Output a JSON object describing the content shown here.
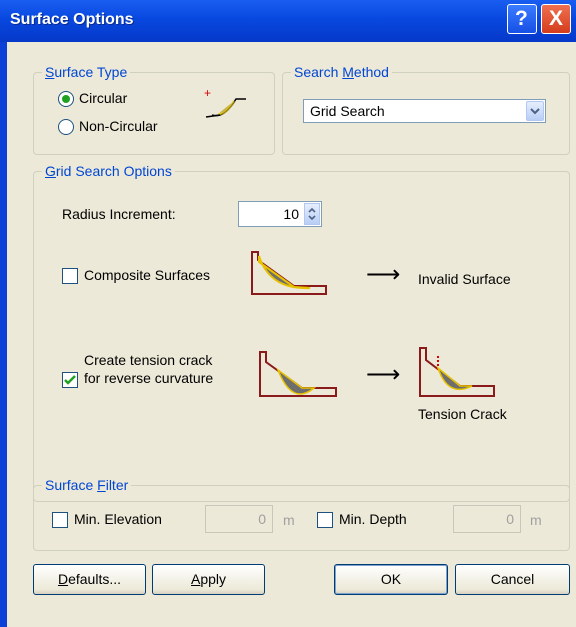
{
  "window": {
    "title": "Surface Options",
    "help_glyph": "?",
    "close_glyph": "X"
  },
  "surface_type": {
    "legend_prefix": "",
    "legend_u": "S",
    "legend_rest": "urface Type",
    "option_circular": "Circular",
    "option_noncircular": "Non-Circular",
    "selected": "Circular"
  },
  "search_method": {
    "legend_pre": "Search ",
    "legend_u": "M",
    "legend_rest": "ethod",
    "value": "Grid Search"
  },
  "grid_options": {
    "legend_u": "G",
    "legend_rest": "rid Search Options",
    "radius_label": "Radius Increment:",
    "radius_value": "10",
    "composite_label": "Composite Surfaces",
    "composite_checked": false,
    "invalid_label": "Invalid Surface",
    "tension_label_1": "Create tension crack",
    "tension_label_2": "for reverse curvature",
    "tension_checked": true,
    "tension_result": "Tension Crack",
    "arrow": "⟶"
  },
  "surface_filter": {
    "legend_pre": "Surface ",
    "legend_u": "F",
    "legend_rest": "ilter",
    "min_elevation_label": "Min. Elevation",
    "min_elevation_value": "0",
    "min_elevation_unit": "m",
    "min_depth_label": "Min. Depth",
    "min_depth_value": "0",
    "min_depth_unit": "m"
  },
  "buttons": {
    "defaults_u": "D",
    "defaults_rest": "efaults...",
    "apply_u": "A",
    "apply_rest": "pply",
    "ok": "OK",
    "cancel": "Cancel"
  },
  "colors": {
    "title_bar": "#0848e0",
    "accent_green": "#21a121",
    "legend_blue": "#0046d5",
    "slope_outline": "#8b1a1a",
    "slope_fill": "#6e6e6e"
  }
}
